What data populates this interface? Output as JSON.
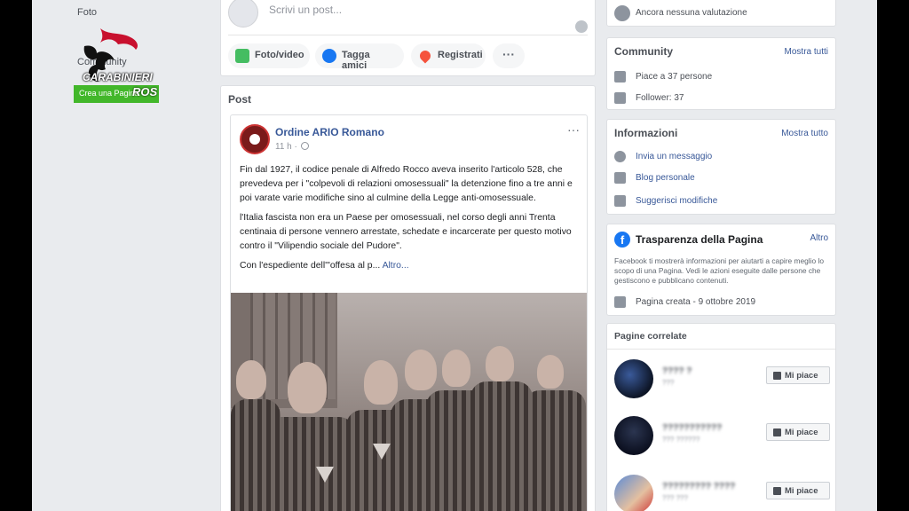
{
  "left": {
    "foto_label": "Foto",
    "community_label": "Community",
    "green_button": "Crea una Pagina",
    "watermark": {
      "line1": "CARABINIERI",
      "line2": "ROS"
    }
  },
  "composer": {
    "placeholder": "Scrivi un post...",
    "buttons": [
      "Foto/video",
      "Tagga amici",
      "Registrati",
      "···"
    ]
  },
  "post_section": {
    "title": "Post",
    "page_name": "Ordine ARIO Romano",
    "time": "11 h ·",
    "menu": "···",
    "paragraphs": [
      "Fin dal 1927, il codice penale di Alfredo Rocco aveva inserito l'articolo 528, che prevedeva per i \"colpevoli di relazioni omosessuali\" la detenzione fino a tre anni e poi varate varie modifiche sino al culmine della Legge anti-omosessuale.",
      "l'Italia fascista non era un Paese per omosessuali, nel corso degli anni Trenta centinaia di persone vennero arrestate, schedate e incarcerate per questo motivo contro il \"Vilipendio sociale del Pudore\"."
    ],
    "last_line": "Con l'espediente dell'\"offesa al p...",
    "more_link": "Altro..."
  },
  "right": {
    "ratings_text": "Ancora nessuna valutazione",
    "community": {
      "title": "Community",
      "link": "Mostra tutti",
      "likes": "Piace a 37 persone",
      "followers": "Follower: 37"
    },
    "info": {
      "title": "Informazioni",
      "link": "Mostra tutto",
      "message": "Invia un messaggio",
      "blog": "Blog personale",
      "suggest": "Suggerisci modifiche"
    },
    "transparency": {
      "title": "Trasparenza della Pagina",
      "link": "Altro",
      "description": "Facebook ti mostrerà informazioni per aiutarti a capire meglio lo scopo di una Pagina. Vedi le azioni eseguite dalle persone che gestiscono e pubblicano contenuti.",
      "created": "Pagina creata - 9 ottobre 2019"
    },
    "related": {
      "title": "Pagine correlate",
      "button_label": "Mi piace",
      "items": [
        {
          "name": "???? ?",
          "sub": "???"
        },
        {
          "name": "???????????",
          "sub": "??? ??????"
        },
        {
          "name": "????????? ????",
          "sub": "??? ???"
        }
      ]
    }
  }
}
